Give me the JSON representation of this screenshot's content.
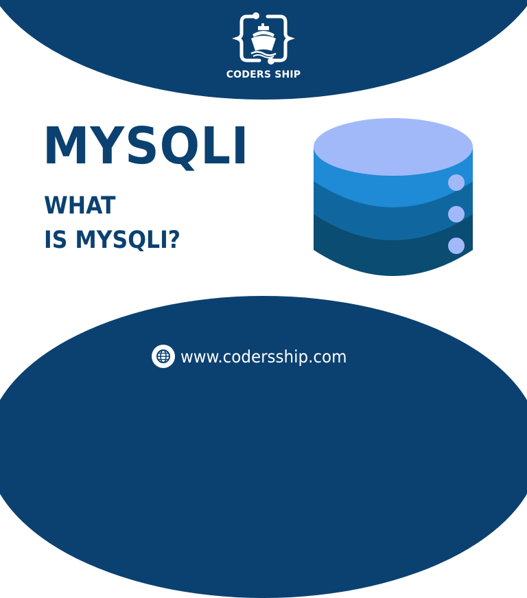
{
  "brand": {
    "name": "CODERS SHIP",
    "logo_icon": "ship-in-braces-icon"
  },
  "hero": {
    "title": "MYSQLI",
    "subtitle_line1": "WHAT",
    "subtitle_line2": "IS MYSQLI?",
    "illustration": "database-icon"
  },
  "footer": {
    "website": "www.codersship.com",
    "icon": "globe-icon"
  },
  "colors": {
    "primary": "#0b4170",
    "background": "#ffffff",
    "db_top": "#a2b9f9",
    "db_layer1": "#1f8ad6",
    "db_layer2": "#10679f",
    "db_layer3": "#0a4c72",
    "db_dots": "#a2b9f9"
  }
}
